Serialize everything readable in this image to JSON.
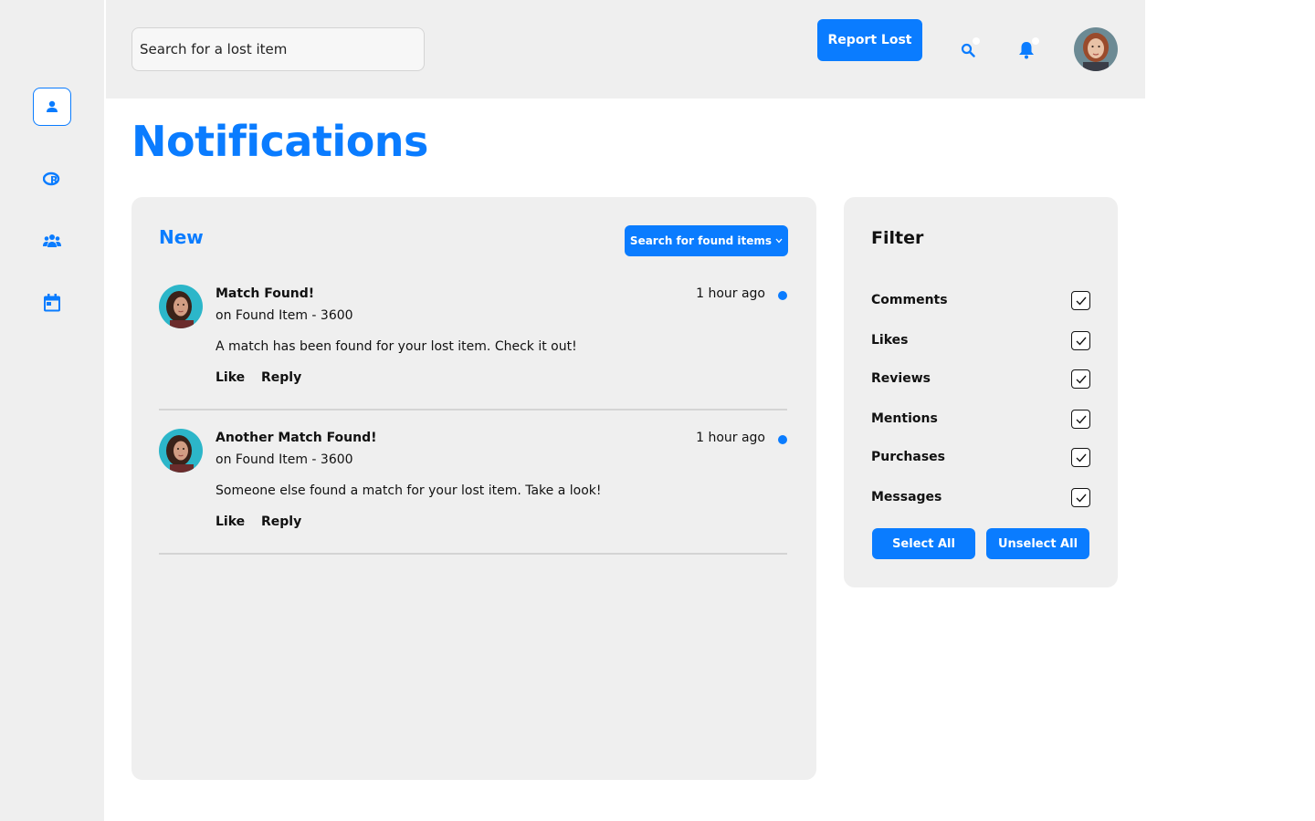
{
  "topbar": {
    "search_placeholder": "Search for a lost item",
    "report_label": "Report Lost"
  },
  "page": {
    "title": "Notifications"
  },
  "notifications": {
    "section_label": "New",
    "dropdown_label": "Search for found items",
    "items": [
      {
        "title": "Match Found!",
        "subtitle": "on Found Item - 3600",
        "body": "A match has been found for your lost item. Check it out!",
        "time": "1 hour ago",
        "like": "Like",
        "reply": "Reply"
      },
      {
        "title": "Another Match Found!",
        "subtitle": "on Found Item - 3600",
        "body": "Someone else found a match for your lost item. Take a look!",
        "time": "1 hour ago",
        "like": "Like",
        "reply": "Reply"
      }
    ]
  },
  "filter": {
    "title": "Filter",
    "options": [
      {
        "label": "Comments",
        "checked": true
      },
      {
        "label": "Likes",
        "checked": true
      },
      {
        "label": "Reviews",
        "checked": true
      },
      {
        "label": "Mentions",
        "checked": true
      },
      {
        "label": "Purchases",
        "checked": true
      },
      {
        "label": "Messages",
        "checked": true
      }
    ],
    "select_all": "Select All",
    "unselect_all": "Unselect All"
  },
  "sidebar": {
    "items": [
      {
        "icon": "user-icon",
        "active": true
      },
      {
        "icon": "registered-icon",
        "active": false
      },
      {
        "icon": "users-icon",
        "active": false
      },
      {
        "icon": "calendar-icon",
        "active": false
      }
    ]
  },
  "colors": {
    "accent": "#0a7cff",
    "panel": "#efefef"
  }
}
